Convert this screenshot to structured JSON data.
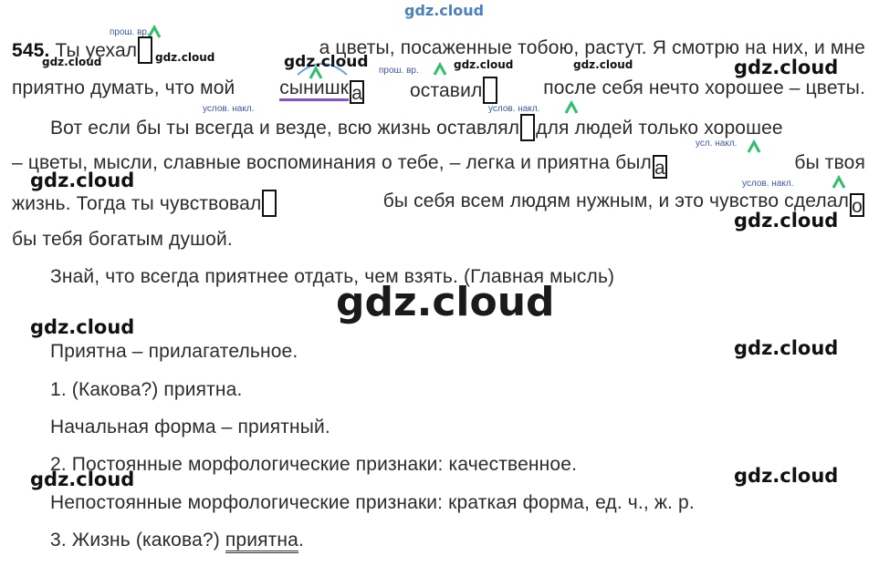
{
  "watermark": "gdz.cloud",
  "annotations": {
    "past_tense": "прош. вр.",
    "conditional": "услов. накл.",
    "conditional_short": "усл. накл."
  },
  "text": {
    "num": "545.",
    "l1_a": "Ты уехал",
    "l1_b": "а цветы, посаженные тобою, растут. Я смотрю на них, и мне",
    "l2_a": "приятно думать, что мой",
    "l2_stem": "сынишк",
    "l2_end": "а",
    "l2_b": "оставил",
    "l2_c": "после себя нечто хорошее – цветы.",
    "l3_a": "Вот если бы ты всегда и везде, всю жизнь оставлял",
    "l3_b": "для людей только хорошее",
    "l4_a": "– цветы, мысли, славные воспоминания о тебе, – легка и приятна был",
    "l4_end": "а",
    "l4_b": "бы твоя",
    "l5_a": "жизнь. Тогда ты чувствовал",
    "l5_b": "бы себя всем людям нужным, и это чувство сделал",
    "l5_end": "о",
    "l6": "бы тебя богатым душой.",
    "l7": "Знай, что всегда приятнее отдать, чем взять. (Главная мысль)",
    "p1": "Приятна – прилагательное.",
    "p2": "1. (Какова?) приятна.",
    "p3": "Начальная форма – приятный.",
    "p4": "2. Постоянные морфологические признаки: качественное.",
    "p5": "Непостоянные морфологические признаки: краткая форма, ед. ч., ж. р.",
    "p6_a": "3. Жизнь (какова?)",
    "p6_b": "приятна",
    "p6_c": "."
  },
  "colors": {
    "accent_green": "#2fbf6a",
    "annotation_blue": "#3a57b0",
    "underline_purple": "#8b4fc9",
    "arc_blue": "#5aa8e6"
  }
}
